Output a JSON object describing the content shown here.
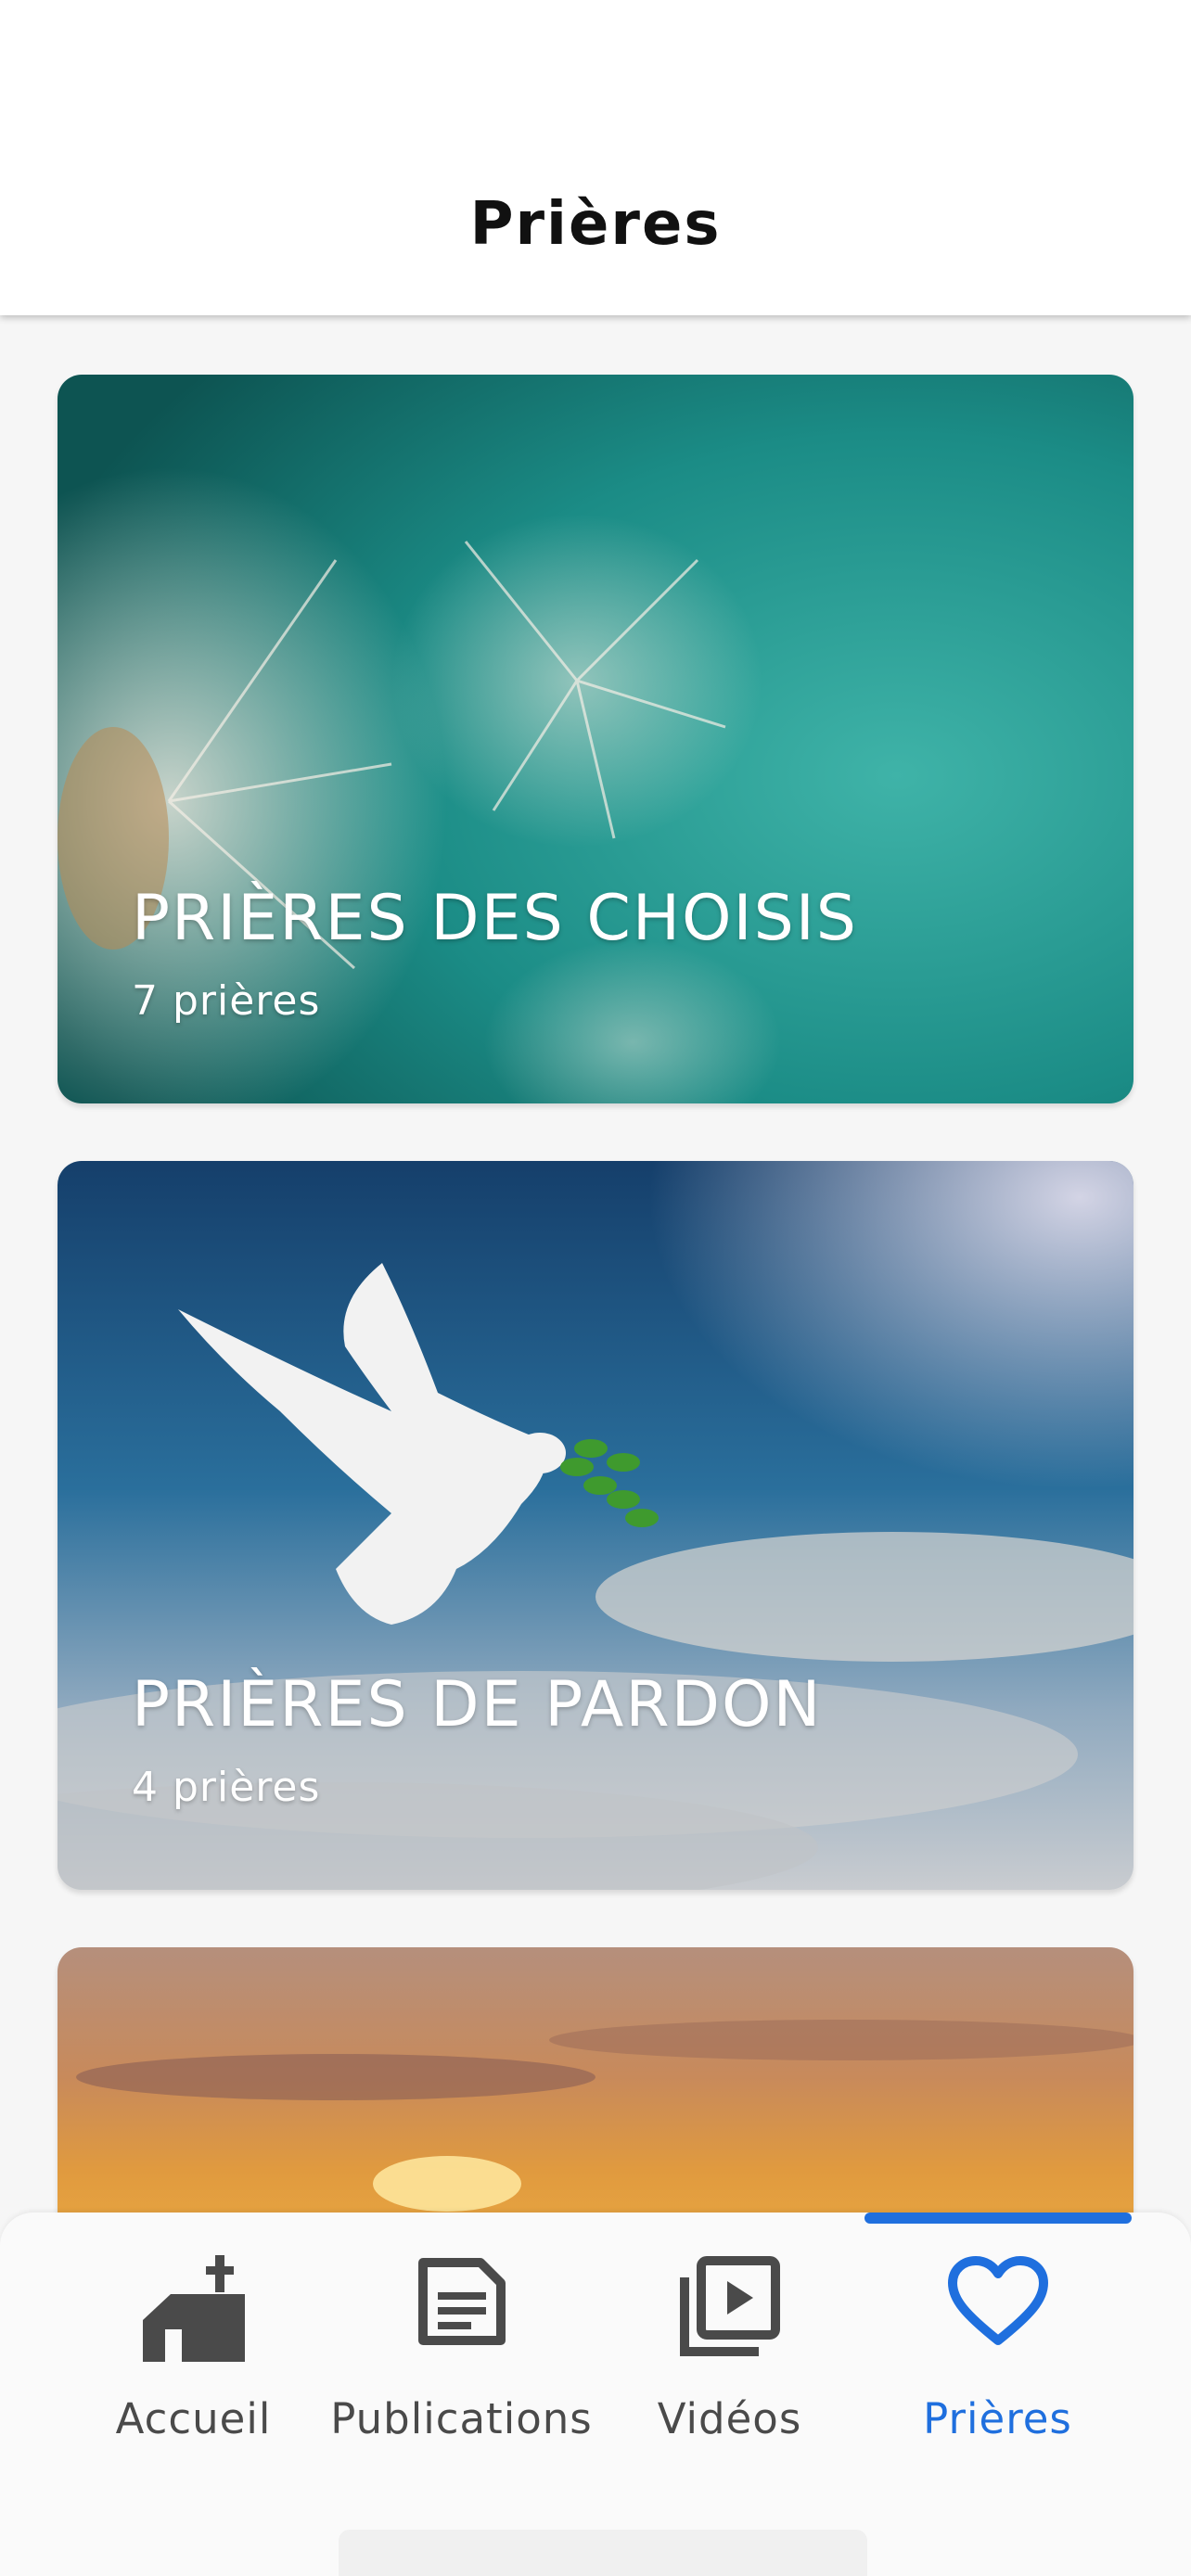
{
  "header": {
    "title": "Prières"
  },
  "cards": [
    {
      "title": "PRIÈRES DES CHOISIS",
      "count": "7 prières",
      "image": "dandelion-image"
    },
    {
      "title": "PRIÈRES DE PARDON",
      "count": "4 prières",
      "image": "dove-image"
    },
    {
      "title": "",
      "count": "",
      "image": "sunset-image"
    }
  ],
  "tabbar": {
    "active": "Prières",
    "accent_color": "#1f6fde",
    "items": [
      {
        "label": "Accueil",
        "icon": "church-icon"
      },
      {
        "label": "Publications",
        "icon": "article-icon"
      },
      {
        "label": "Vidéos",
        "icon": "video-library-icon"
      },
      {
        "label": "Prières",
        "icon": "heart-icon"
      }
    ]
  }
}
